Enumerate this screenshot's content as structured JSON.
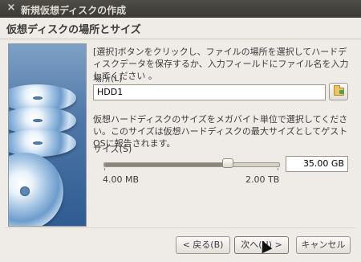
{
  "window": {
    "title": "新規仮想ディスクの作成",
    "close_glyph": "×"
  },
  "page": {
    "heading": "仮想ディスクの場所とサイズ",
    "description": "[選択]ボタンをクリックし、ファイルの場所を選択してハードディスクデータを保存するか、入力フィールドにファイル名を入力してください 。"
  },
  "location": {
    "label": "場所(L)",
    "value": "HDD1",
    "browse_icon": "folder-icon"
  },
  "size": {
    "description": "仮想ハードディスクのサイズをメガバイト単位で選択してください。このサイズは仮想ハードディスクの最大サイズとしてゲストOSに報告されます。",
    "label": "サイズ(S)",
    "value": "35.00 GB",
    "min_label": "4.00 MB",
    "max_label": "2.00 TB",
    "slider_fraction": 0.71
  },
  "buttons": {
    "back": "< 戻る(B)",
    "next": "次へ(N) >",
    "cancel": "キャンセル"
  }
}
